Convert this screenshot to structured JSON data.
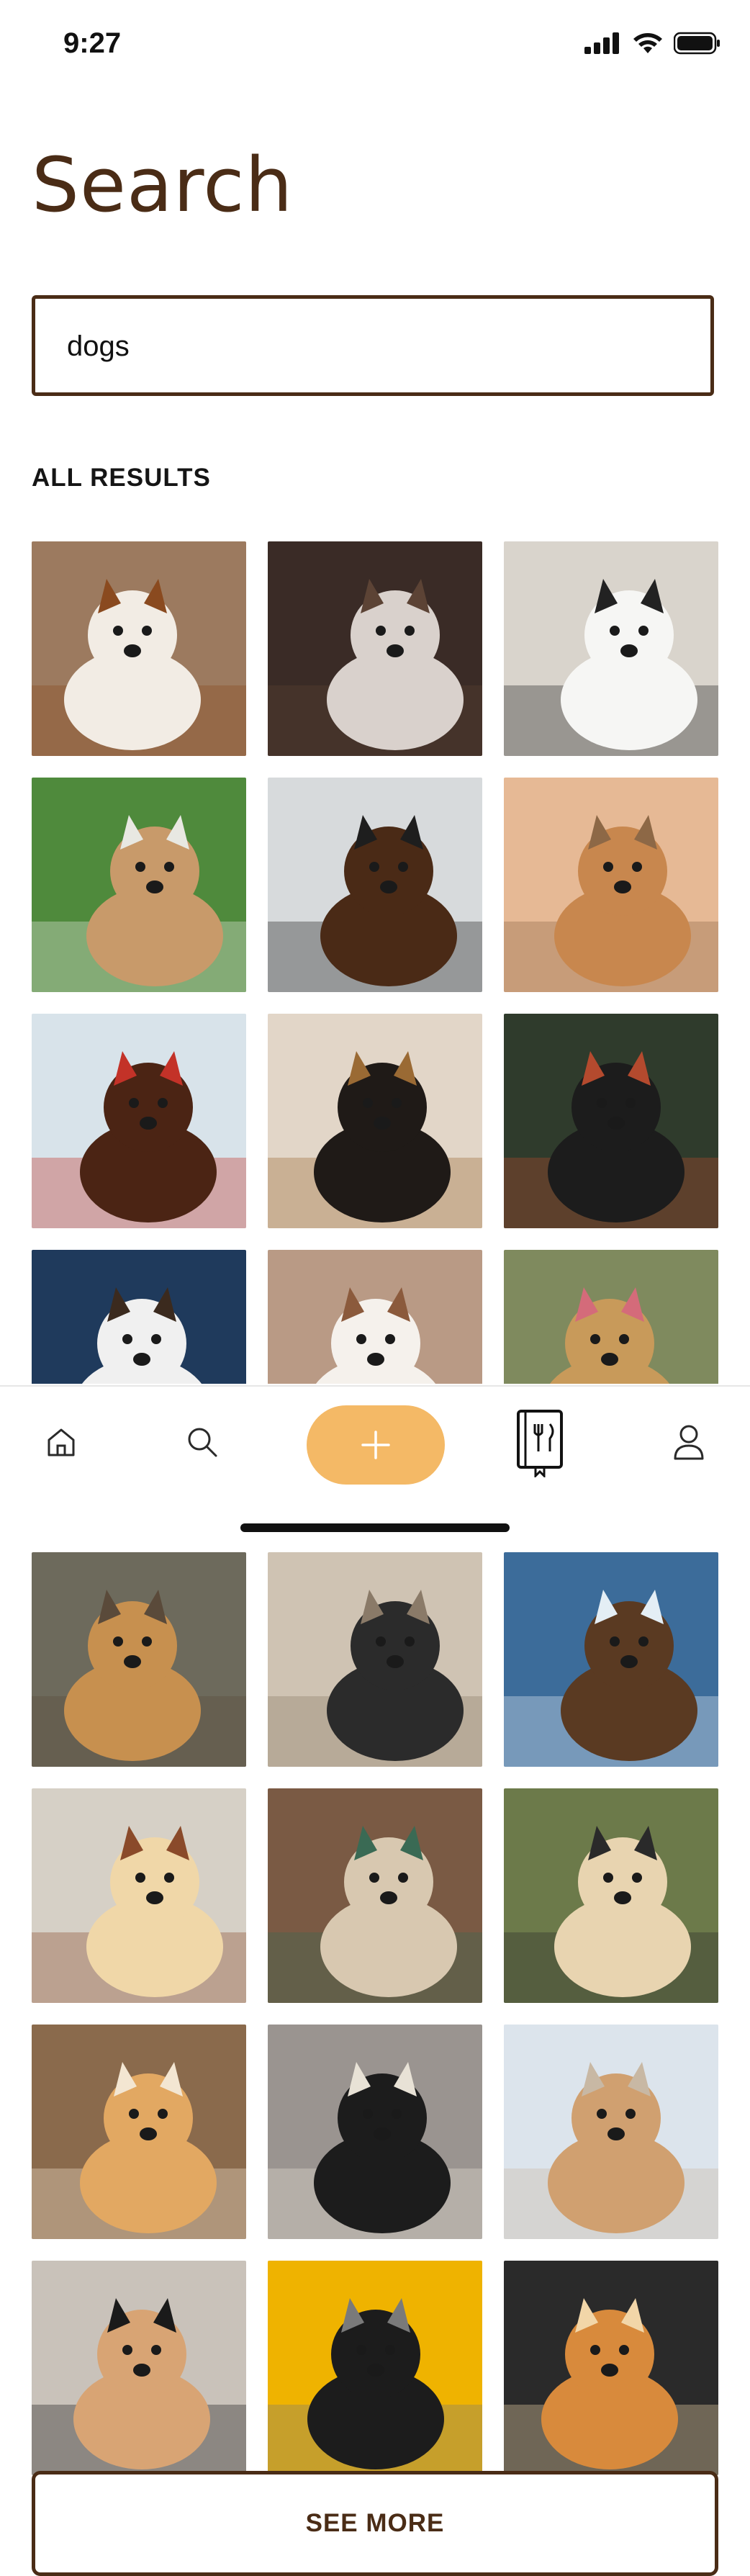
{
  "status_bar": {
    "time": "9:27",
    "icons": [
      "signal-icon",
      "wifi-icon",
      "battery-icon"
    ]
  },
  "page": {
    "title": "Search"
  },
  "search": {
    "value": "dogs"
  },
  "results": {
    "section_label": "ALL RESULTS",
    "top_images": [
      {
        "name": "dog-photo-white-brown-face",
        "bg": "#9c7a5f",
        "subject": "#f2ece4",
        "accent": "#8a4a1f"
      },
      {
        "name": "dog-photo-husky-on-couch",
        "bg": "#3a2b26",
        "subject": "#d9d1cc",
        "accent": "#5c4335"
      },
      {
        "name": "dog-photo-dalmatian-lying",
        "bg": "#d9d4cc",
        "subject": "#f6f6f4",
        "accent": "#222222"
      },
      {
        "name": "dog-photo-dogs-on-grass",
        "bg": "#4f8a3c",
        "subject": "#c89a6a",
        "accent": "#e8e8e2"
      },
      {
        "name": "dog-photo-spaniels-sunglasses",
        "bg": "#d7dadc",
        "subject": "#4a2a16",
        "accent": "#1e1e1e"
      },
      {
        "name": "dog-photo-corgi-terrier-running",
        "bg": "#e6b995",
        "subject": "#c8874e",
        "accent": "#8d6846"
      },
      {
        "name": "dog-photo-chocolate-labrador",
        "bg": "#d8e3ea",
        "subject": "#4b2414",
        "accent": "#c33228"
      },
      {
        "name": "dog-photo-german-shepherd-beach",
        "bg": "#e2d6c8",
        "subject": "#1f1a17",
        "accent": "#9a6a34"
      },
      {
        "name": "dog-photo-two-dogs-bandanas",
        "bg": "#2f3b2c",
        "subject": "#1c1c1c",
        "accent": "#b44a2e"
      },
      {
        "name": "dog-photo-dogs-blue-door",
        "bg": "#1f3a5c",
        "subject": "#f0f0f0",
        "accent": "#3b2a1e"
      },
      {
        "name": "dog-photo-two-white-puppies",
        "bg": "#b99a85",
        "subject": "#f5f1ec",
        "accent": "#8b5a3c"
      },
      {
        "name": "dog-photo-golden-tongue",
        "bg": "#7f8a5e",
        "subject": "#c89a5a",
        "accent": "#d46b7a"
      }
    ],
    "bottom_images": [
      {
        "name": "dog-photo-three-puppies",
        "bg": "#6d6a5c",
        "subject": "#c7904f",
        "accent": "#5a4a3a"
      },
      {
        "name": "dog-photo-pug-in-swing",
        "bg": "#cfc3b3",
        "subject": "#2b2b2b",
        "accent": "#8a7a68"
      },
      {
        "name": "dog-photo-dog-swimming",
        "bg": "#3c6c9a",
        "subject": "#5a3a22",
        "accent": "#e4eef5"
      },
      {
        "name": "dog-photo-yellow-labrador",
        "bg": "#d6d0c6",
        "subject": "#f0d7a8",
        "accent": "#8a4a2a"
      },
      {
        "name": "dog-photo-pack-on-street",
        "bg": "#7a5a44",
        "subject": "#d8c8b0",
        "accent": "#3a6a54"
      },
      {
        "name": "dog-photo-three-pugs",
        "bg": "#6c7a4a",
        "subject": "#e8d4b0",
        "accent": "#2a2a2a"
      },
      {
        "name": "dog-photo-golden-retriever",
        "bg": "#8a6a4c",
        "subject": "#e2a862",
        "accent": "#f3e6d2"
      },
      {
        "name": "dog-photo-two-dogs-on-rug",
        "bg": "#9a9490",
        "subject": "#1c1c1c",
        "accent": "#e8e2d6"
      },
      {
        "name": "dog-photo-spaniel-on-beach",
        "bg": "#dce4ec",
        "subject": "#d0a070",
        "accent": "#c8b8a4"
      },
      {
        "name": "dog-photo-fluffy-sunglasses",
        "bg": "#c9c2ba",
        "subject": "#d8a474",
        "accent": "#1a1a1a"
      },
      {
        "name": "dog-photo-pug-yellow-background",
        "bg": "#efb300",
        "subject": "#1c1c1c",
        "accent": "#7a7a7a"
      },
      {
        "name": "dog-photo-resting-spaniel",
        "bg": "#2a2a2a",
        "subject": "#d88a3c",
        "accent": "#f2d6a8"
      }
    ]
  },
  "nav": {
    "items": [
      "home-icon",
      "search-icon",
      "plus-icon",
      "recipe-book-icon",
      "profile-icon"
    ],
    "active_color": "#f4b966"
  },
  "actions": {
    "see_more_label": "SEE MORE"
  },
  "colors": {
    "brand_brown": "#4a2c16",
    "accent_orange": "#f4b966"
  }
}
